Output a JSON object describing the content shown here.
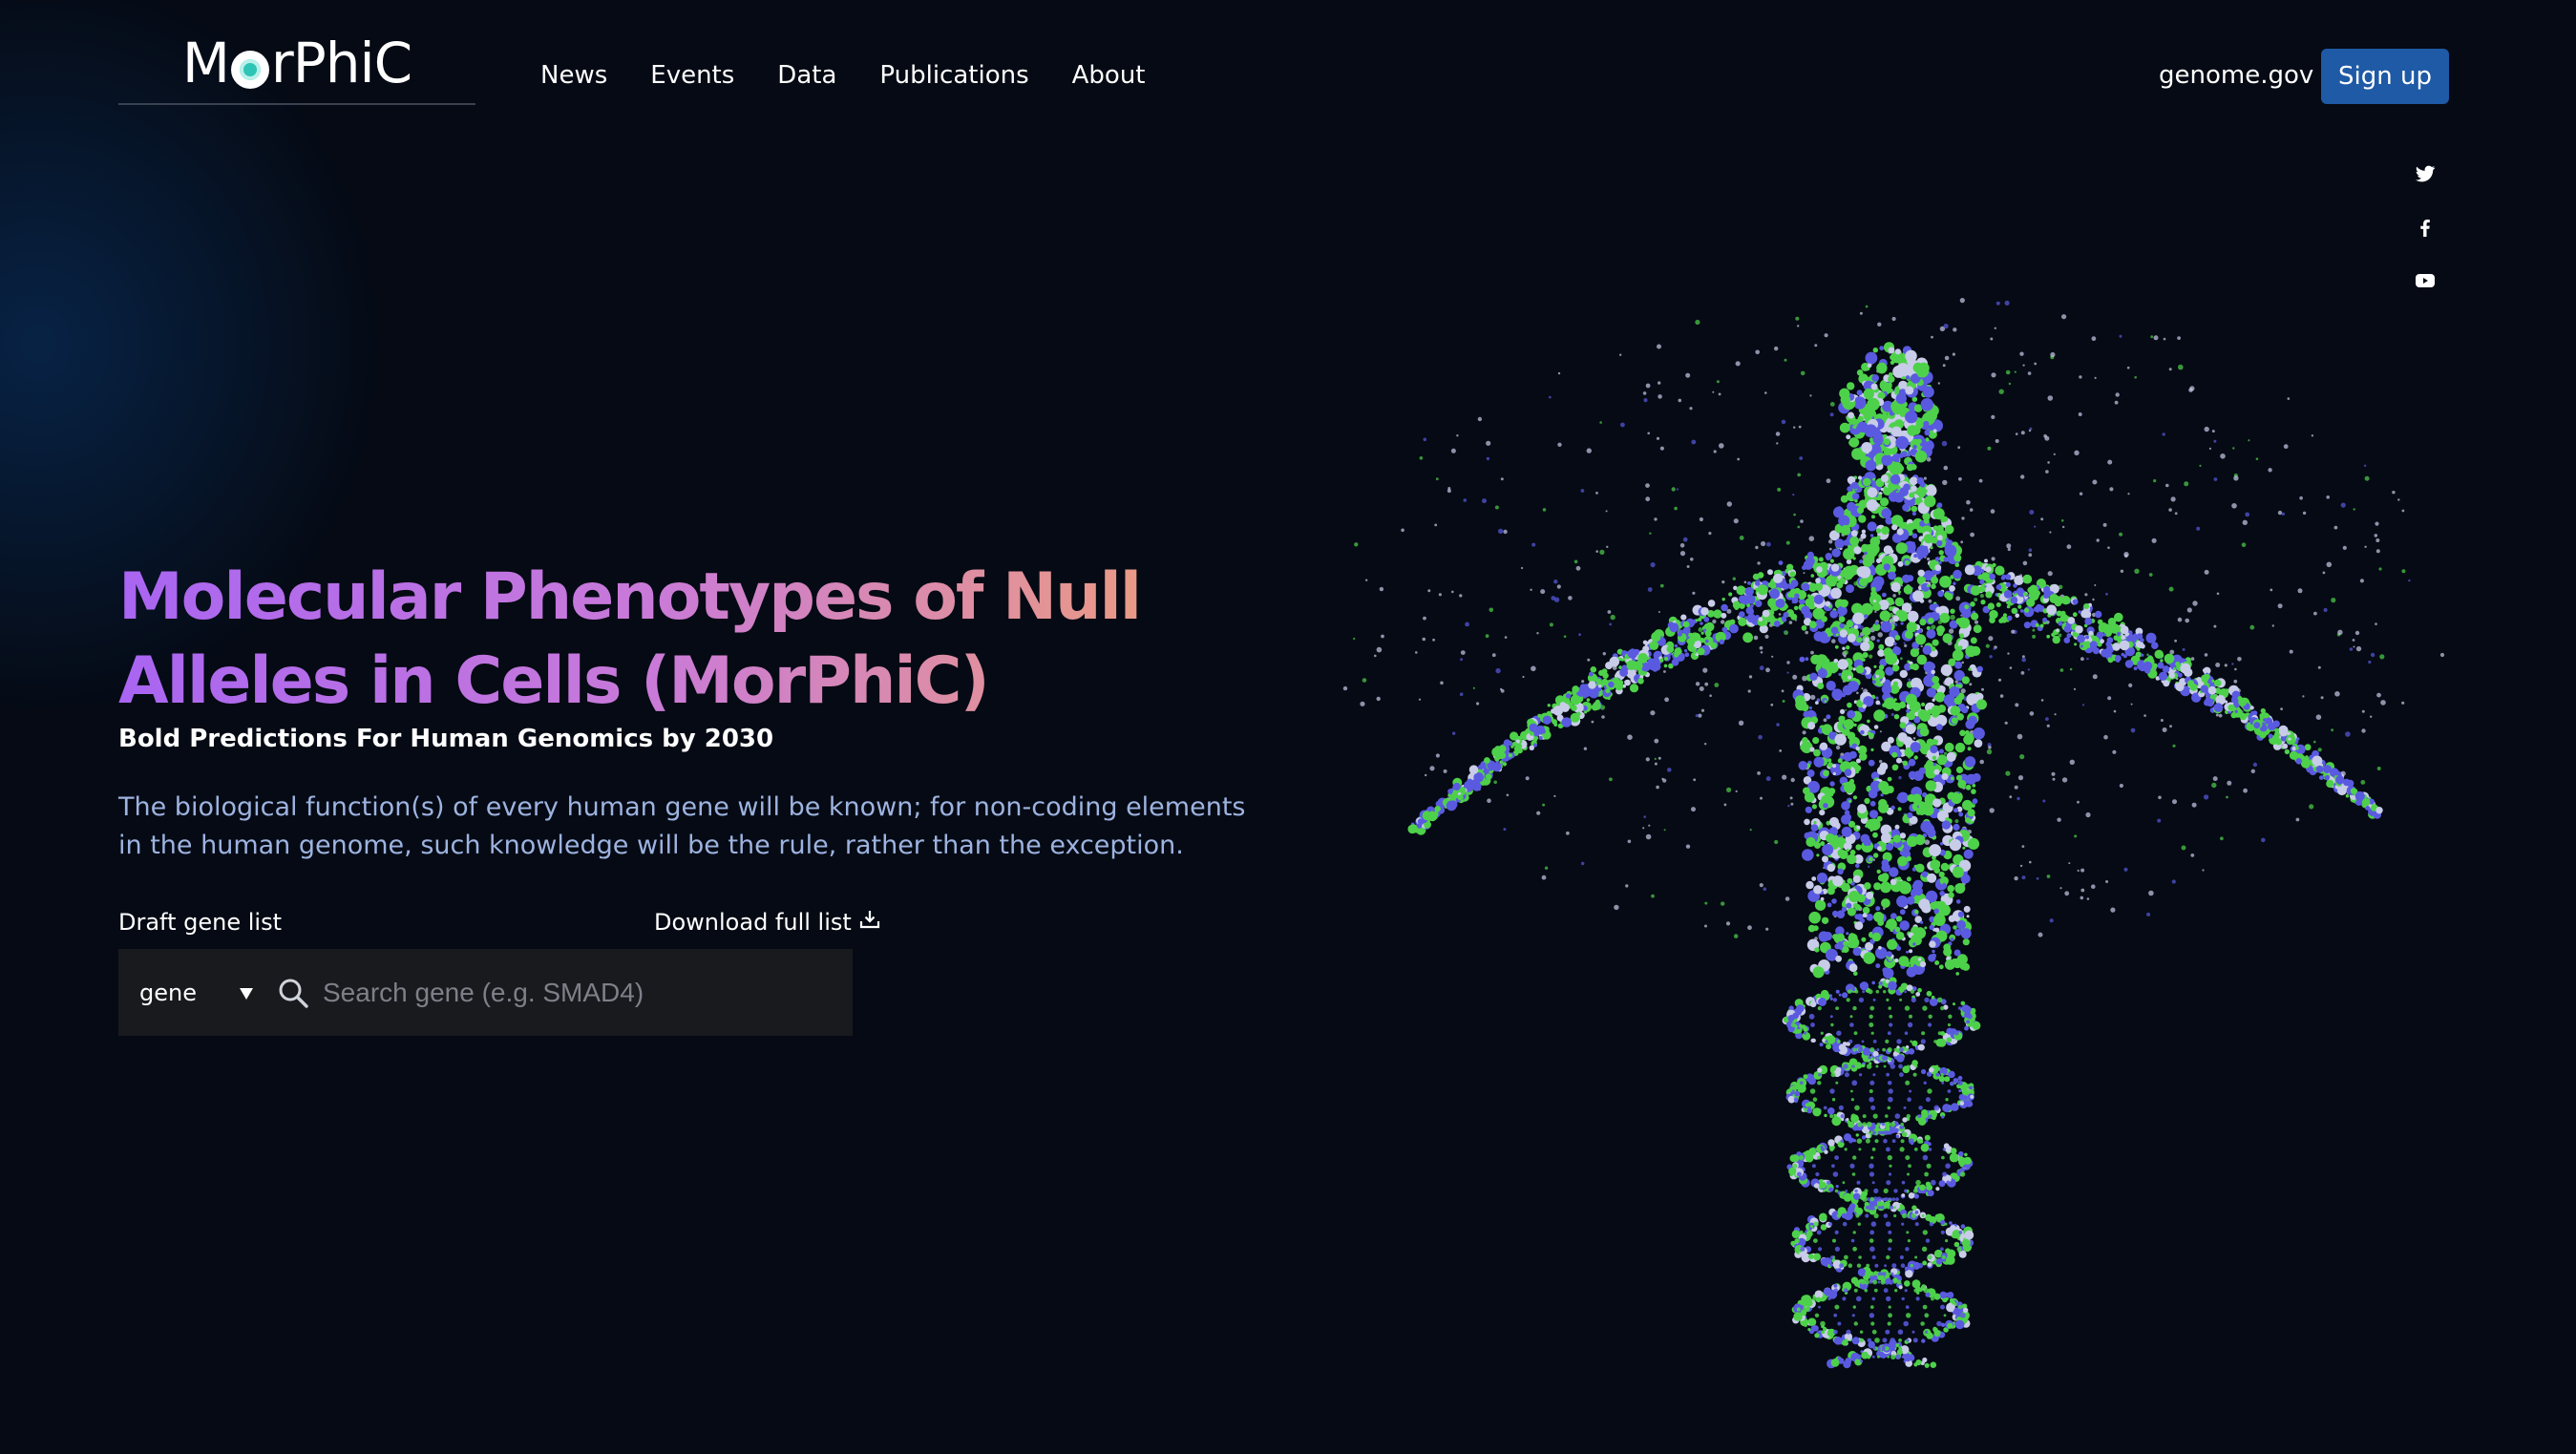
{
  "header": {
    "logo_text": "MorPhiC",
    "nav": [
      "News",
      "Events",
      "Data",
      "Publications",
      "About"
    ],
    "genome_link": "genome.gov",
    "signup_label": "Sign up"
  },
  "social": [
    "twitter-icon",
    "facebook-icon",
    "youtube-icon"
  ],
  "hero": {
    "title": "Molecular Phenotypes of Null Alleles in Cells (MorPhiC)",
    "subtitle": "Bold Predictions For Human Genomics by 2030",
    "description": "The biological function(s) of every human gene will be known; for non-coding elements in the human genome, such knowledge will be the rule, rather than the exception."
  },
  "gene_search": {
    "label": "Draft gene list",
    "download_label": "Download full list",
    "select_value": "gene",
    "placeholder": "Search gene (e.g. SMAD4)"
  },
  "colors": {
    "background": "#050a14",
    "signup": "#1e5aa6",
    "title_gradient": [
      "#a965f2",
      "#f4a46a"
    ],
    "description": "#9db3e0",
    "dna_green": "#4ed14a",
    "dna_blue": "#5a5ae0"
  }
}
